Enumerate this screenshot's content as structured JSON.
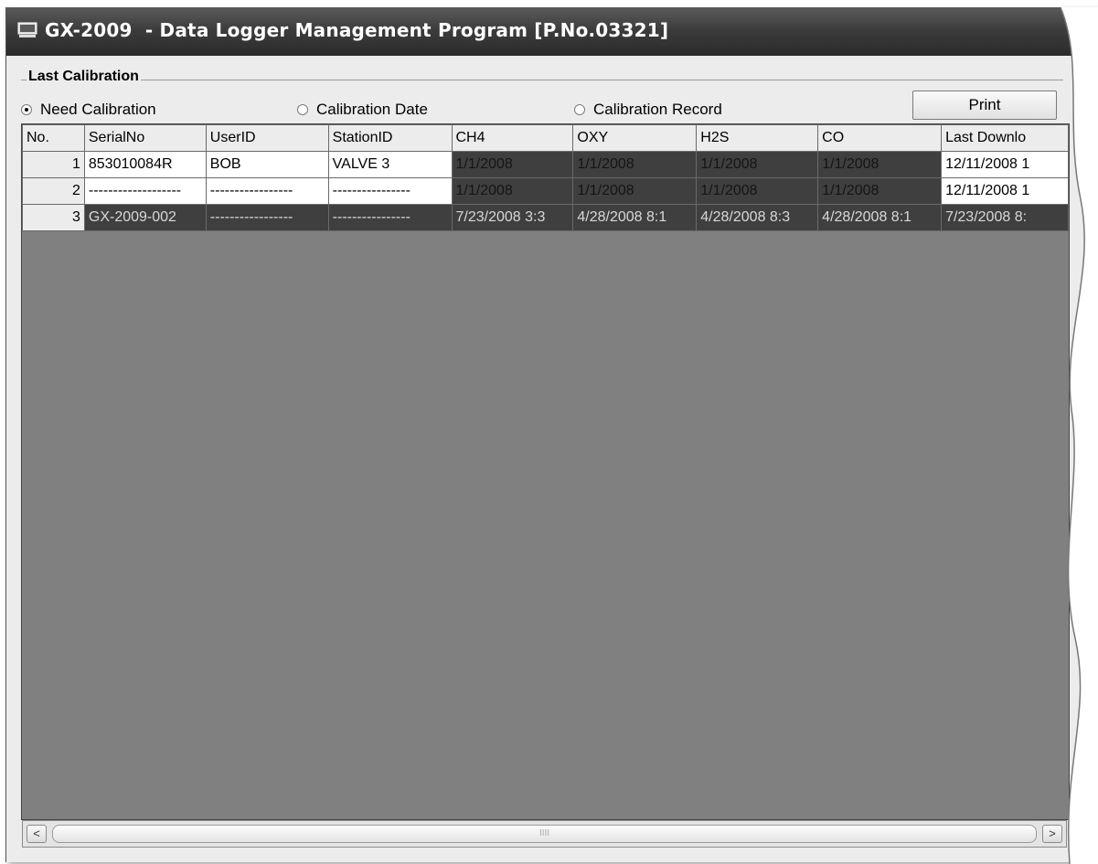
{
  "window": {
    "title": "GX-2009  - Data Logger Management Program [P.No.03321]",
    "icon": "monitor-icon"
  },
  "group": {
    "label": "Last Calibration"
  },
  "radios": [
    {
      "label": "Need Calibration",
      "checked": true
    },
    {
      "label": "Calibration Date",
      "checked": false
    },
    {
      "label": "Calibration Record",
      "checked": false
    }
  ],
  "print_button": {
    "label": "Print"
  },
  "table": {
    "columns": [
      "No.",
      "SerialNo",
      "UserID",
      "StationID",
      "CH4",
      "OXY",
      "H2S",
      "CO",
      "Last Downlo"
    ],
    "rows": [
      [
        "1",
        "853010084R",
        "BOB",
        "VALVE 3",
        "1/1/2008",
        "1/1/2008",
        "1/1/2008",
        "1/1/2008",
        "12/11/2008 1"
      ],
      [
        "2",
        "-------------------",
        "-----------------",
        "----------------",
        "1/1/2008",
        "1/1/2008",
        "1/1/2008",
        "1/1/2008",
        "12/11/2008 1"
      ],
      [
        "3",
        "GX-2009-002",
        "-----------------",
        "----------------",
        "7/23/2008 3:3",
        "4/28/2008 8:1",
        "4/28/2008 8:3",
        "4/28/2008 8:1",
        "7/23/2008 8:"
      ]
    ]
  },
  "scrollbar": {
    "left_arrow": "<",
    "right_arrow": ">",
    "thumb_grip": "IIII"
  },
  "colors": {
    "titlebar": "#3c3c3c",
    "grid_background": "#808080",
    "highlight_cell": "#3f3f3f"
  }
}
